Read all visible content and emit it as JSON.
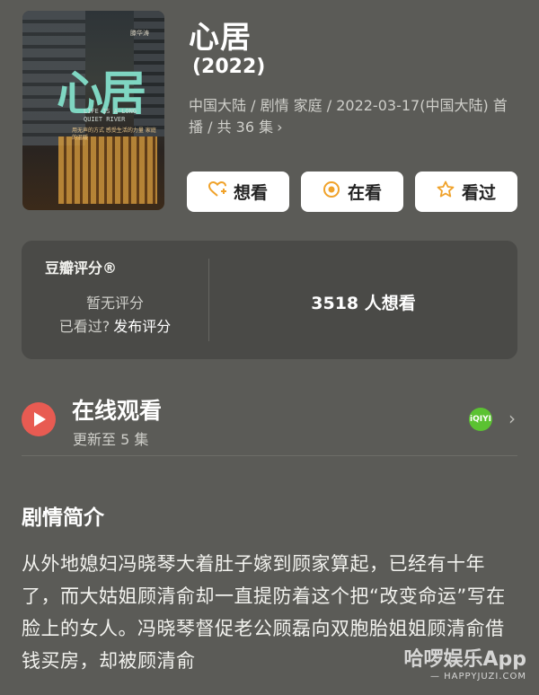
{
  "poster": {
    "title": "心居",
    "tag": "滕华涛",
    "subtitle": "LIFE IS A LONG QUIET RIVER",
    "note": "用无声的方式 感受生活的力量 家庭的温暖"
  },
  "show": {
    "title": "心居",
    "year": "(2022)",
    "meta": "中国大陆 / 剧情 家庭 / 2022-03-17(中国大陆) 首播 / 共 36 集",
    "meta_chevron": "›"
  },
  "actions": [
    {
      "label": "想看",
      "icon": "heart-plus-icon"
    },
    {
      "label": "在看",
      "icon": "target-icon"
    },
    {
      "label": "看过",
      "icon": "star-icon"
    }
  ],
  "rating": {
    "label": "豆瓣评分®",
    "no_score": "暂无评分",
    "seen_question": "已看过?",
    "post_rating": "发布评分",
    "want_count": "3518 人想看"
  },
  "watch": {
    "title": "在线观看",
    "subtitle": "更新至 5 集",
    "platform_icon": "iqiyi-icon",
    "platform_text": "iQIYI",
    "chevron": "›"
  },
  "synopsis": {
    "title": "剧情简介",
    "text": "从外地媳妇冯晓琴大着肚子嫁到顾家算起，已经有十年了，而大姑姐顾清俞却一直提防着这个把“改变命运”写在脸上的女人。冯晓琴督促老公顾磊向双胞胎姐姐顾清俞借钱买房，却被顾清俞"
  },
  "watermark": {
    "line1": "哈啰娱乐App",
    "line2": "— HAPPYJUZI.COM"
  }
}
